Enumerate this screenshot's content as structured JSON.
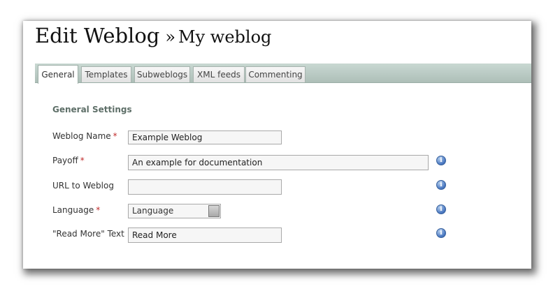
{
  "header": {
    "title": "Edit Weblog",
    "separator": "»",
    "subtitle": "My weblog"
  },
  "tabs": [
    {
      "label": "General",
      "active": true
    },
    {
      "label": "Templates"
    },
    {
      "label": "Subweblogs"
    },
    {
      "label": "XML feeds"
    },
    {
      "label": "Commenting"
    }
  ],
  "form": {
    "section_title": "General Settings",
    "required_marker": "*",
    "fields": {
      "weblog_name": {
        "label": "Weblog Name",
        "value": "Example Weblog",
        "required": true
      },
      "payoff": {
        "label": "Payoff",
        "value": "An example for documentation",
        "required": true
      },
      "url": {
        "label": "URL to Weblog",
        "value": ""
      },
      "language": {
        "label": "Language",
        "value": "Language",
        "required": true
      },
      "read_more": {
        "label": "\"Read More\" Text",
        "value": "Read More"
      }
    },
    "info_icon_glyph": "i"
  },
  "colors": {
    "tabbar": "#b8cac3",
    "section_title": "#5e6f68",
    "required": "#c02a2a",
    "info_icon": "#4b79c2"
  }
}
